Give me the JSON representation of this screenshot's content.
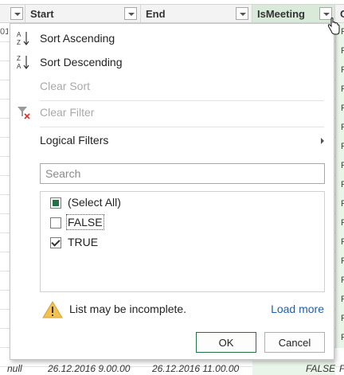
{
  "columns": [
    {
      "label": "Start"
    },
    {
      "label": "End"
    },
    {
      "label": "IsMeeting"
    },
    {
      "label": "C"
    }
  ],
  "left_edge_values": [
    "01",
    "",
    "",
    "",
    "",
    "",
    "",
    "",
    "",
    "",
    "",
    "",
    "",
    "",
    "",
    "",
    "",
    ""
  ],
  "right_edge_values": [
    "F",
    "F",
    "F",
    "F",
    "F",
    "F",
    "F",
    "F",
    "F",
    "F",
    "F",
    "F",
    "F",
    "F",
    "F",
    "F",
    "F"
  ],
  "last_row": {
    "col0": "null",
    "start": "26.12.2016 9.00.00",
    "end": "26.12.2016 11.00.00",
    "is_meeting": "FALSE",
    "extra": "F"
  },
  "menu": {
    "sort_ascending": "Sort Ascending",
    "sort_descending": "Sort Descending",
    "clear_sort": "Clear Sort",
    "clear_filter": "Clear Filter",
    "logical_filters": "Logical Filters"
  },
  "search": {
    "placeholder": "Search",
    "value": ""
  },
  "filter_options": [
    {
      "label": "(Select All)",
      "state": "indeterminate"
    },
    {
      "label": "FALSE",
      "state": "unchecked"
    },
    {
      "label": "TRUE",
      "state": "checked"
    }
  ],
  "warning": {
    "text": "List may be incomplete.",
    "link": "Load more"
  },
  "buttons": {
    "ok": "OK",
    "cancel": "Cancel"
  },
  "colors": {
    "accent": "#217346",
    "link": "#1e5fa8",
    "active_column": "#d9ead8"
  }
}
